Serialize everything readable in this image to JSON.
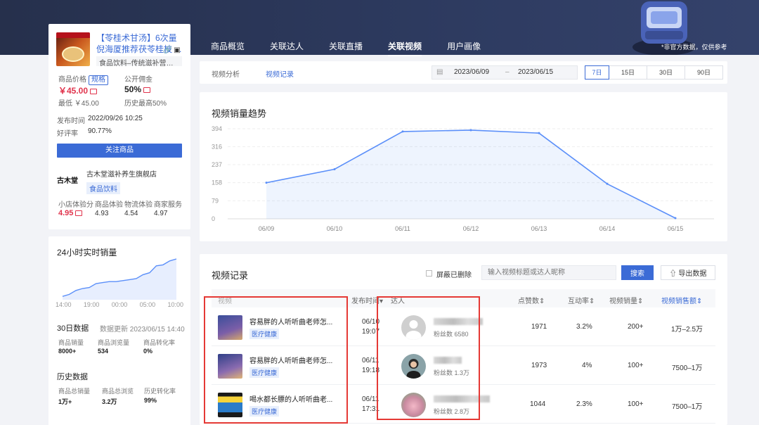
{
  "nav": {
    "tabs": [
      {
        "label": "商品概览"
      },
      {
        "label": "关联达人"
      },
      {
        "label": "关联直播"
      },
      {
        "label": "关联视频"
      },
      {
        "label": "用户画像"
      }
    ],
    "disclaimer": "*非官方数据，仅供参考"
  },
  "product": {
    "title": "【苓桂术甘汤】6次量倪海厦推荐茯苓桂枝 ...",
    "category": "食品饮料–传统滋补营养品...",
    "price_label": "商品价格",
    "spec_tag": "规格",
    "price": "￥45.00",
    "min_price": "最低 ￥45.00",
    "commission_label": "公开佣金",
    "commission": "50%",
    "commission_max": "历史最高50%",
    "publish_label": "发布时间",
    "publish_time": "2022/09/26 10:25",
    "rating_label": "好评率",
    "rating": "90.77%",
    "follow_btn": "关注商品",
    "store_logo": "古木堂",
    "store_name": "古木堂滋补养生旗舰店",
    "store_tag": "食品饮料",
    "scores": [
      {
        "label": "小店体验分",
        "value": "4.95"
      },
      {
        "label": "商品体验",
        "value": "4.93"
      },
      {
        "label": "物流体验",
        "value": "4.54"
      },
      {
        "label": "商家服务",
        "value": "4.97"
      }
    ]
  },
  "realtime": {
    "title": "24小时实时销量",
    "axis": [
      "14:00",
      "19:00",
      "00:00",
      "05:00",
      "10:00"
    ],
    "values": [
      2,
      4,
      8,
      10,
      11,
      15,
      16,
      17,
      17,
      18,
      19,
      20,
      24,
      26,
      33,
      34,
      38,
      40
    ]
  },
  "thirty_day": {
    "title": "30日数据",
    "update": "数据更新 2023/06/15 14:40",
    "stats": [
      {
        "label": "商品销量",
        "value": "8000+"
      },
      {
        "label": "商品浏览量",
        "value": "534"
      },
      {
        "label": "商品转化率",
        "value": "0%"
      }
    ]
  },
  "history": {
    "title": "历史数据",
    "stats": [
      {
        "label": "商品总销量",
        "value": "1万+"
      },
      {
        "label": "商品总浏览",
        "value": "3.2万"
      },
      {
        "label": "历史转化率",
        "value": "99%"
      }
    ]
  },
  "toolbar": {
    "sub_tabs": [
      {
        "label": "视频分析"
      },
      {
        "label": "视频记录"
      }
    ],
    "date_start": "2023/06/09",
    "date_sep": "–",
    "date_end": "2023/06/15",
    "ranges": [
      "7日",
      "15日",
      "30日",
      "90日"
    ]
  },
  "trend": {
    "title": "视频销量趋势"
  },
  "chart_data": {
    "type": "area",
    "title": "视频销量趋势",
    "categories": [
      "06/09",
      "06/10",
      "06/11",
      "06/12",
      "06/13",
      "06/14",
      "06/15"
    ],
    "values": [
      158,
      217,
      382,
      388,
      375,
      153,
      3
    ],
    "y_ticks": [
      0,
      79,
      158,
      237,
      316,
      394
    ],
    "ylim": [
      0,
      394
    ],
    "grid": true,
    "line_color": "#5b8ff9"
  },
  "records": {
    "title": "视频记录",
    "hide_deleted": "屏蔽已删除",
    "search_placeholder": "输入视频标题或达人昵称",
    "search_btn": "搜索",
    "export_btn": "导出数据",
    "headers": {
      "video": "视频",
      "pubtime": "发布时间",
      "talent": "达人",
      "likes": "点赞数",
      "interaction": "互动率",
      "sales": "视频销量",
      "revenue": "视频销售额"
    },
    "rows": [
      {
        "title": "容易胖的人听听曲老师怎...",
        "tag": "医疗健康",
        "date": "06/10",
        "time": "19:07",
        "fans": "粉丝数 6580",
        "likes": "1971",
        "interaction": "3.2%",
        "sales": "200+",
        "revenue": "1万–2.5万"
      },
      {
        "title": "容易胖的人听听曲老师怎...",
        "tag": "医疗健康",
        "date": "06/11",
        "time": "19:18",
        "fans": "粉丝数 1.3万",
        "likes": "1973",
        "interaction": "4%",
        "sales": "100+",
        "revenue": "7500–1万"
      },
      {
        "title": "喝水都长膘的人听听曲老...",
        "tag": "医疗健康",
        "date": "06/11",
        "time": "17:31",
        "fans": "粉丝数 2.8万",
        "likes": "1044",
        "interaction": "2.3%",
        "sales": "100+",
        "revenue": "7500–1万"
      }
    ]
  }
}
